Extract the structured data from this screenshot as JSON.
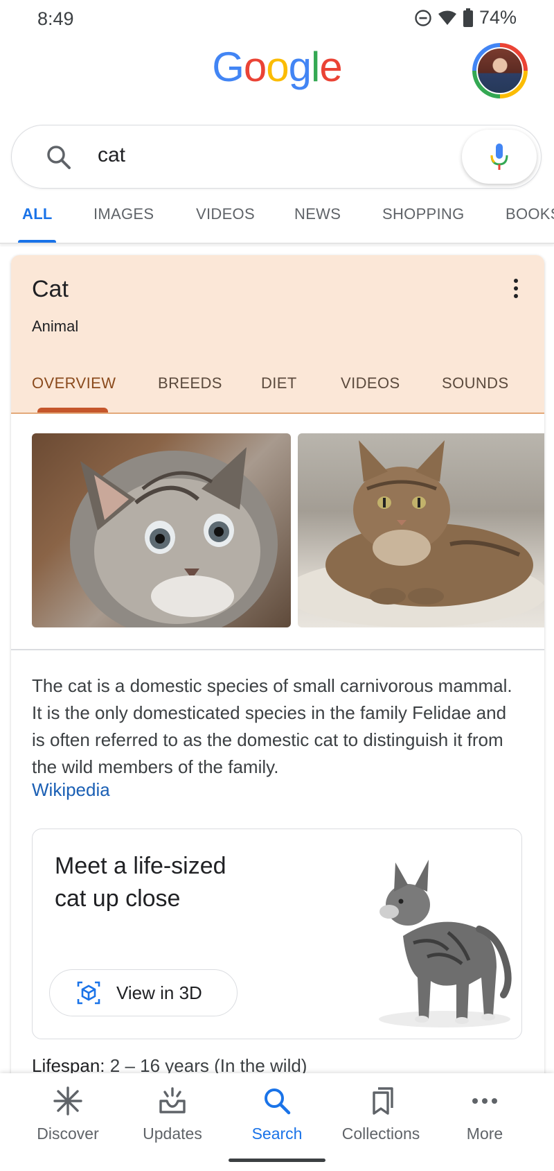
{
  "status_bar": {
    "time": "8:49",
    "battery": "74%"
  },
  "header": {
    "logo_letters": [
      {
        "char": "G",
        "color": "#4285f4"
      },
      {
        "char": "o",
        "color": "#ea4335"
      },
      {
        "char": "o",
        "color": "#fbbc04"
      },
      {
        "char": "g",
        "color": "#4285f4"
      },
      {
        "char": "l",
        "color": "#34a853"
      },
      {
        "char": "e",
        "color": "#ea4335"
      }
    ]
  },
  "search": {
    "query": "cat"
  },
  "tabs": [
    "ALL",
    "IMAGES",
    "VIDEOS",
    "NEWS",
    "SHOPPING",
    "BOOKS"
  ],
  "knowledge_panel": {
    "title": "Cat",
    "subtitle": "Animal",
    "tabs": [
      "OVERVIEW",
      "BREEDS",
      "DIET",
      "VIDEOS",
      "SOUNDS"
    ],
    "description": "The cat is a domestic species of small carnivorous mammal. It is the only domesticated species in the family Felidae and is often referred to as the domestic cat to distinguish it from the wild members of the family.",
    "source_link": "Wikipedia",
    "ar_card": {
      "title": "Meet a life-sized cat up close",
      "button_label": "View in 3D"
    },
    "lifespan_label": "Lifespan:",
    "lifespan_value": "2 – 16 years (In the wild)"
  },
  "bottom_nav": [
    "Discover",
    "Updates",
    "Search",
    "Collections",
    "More"
  ],
  "colors": {
    "accent": "#1a73e8",
    "panel_header": "#fbe7d7",
    "panel_tab_underline": "#c5562b"
  }
}
